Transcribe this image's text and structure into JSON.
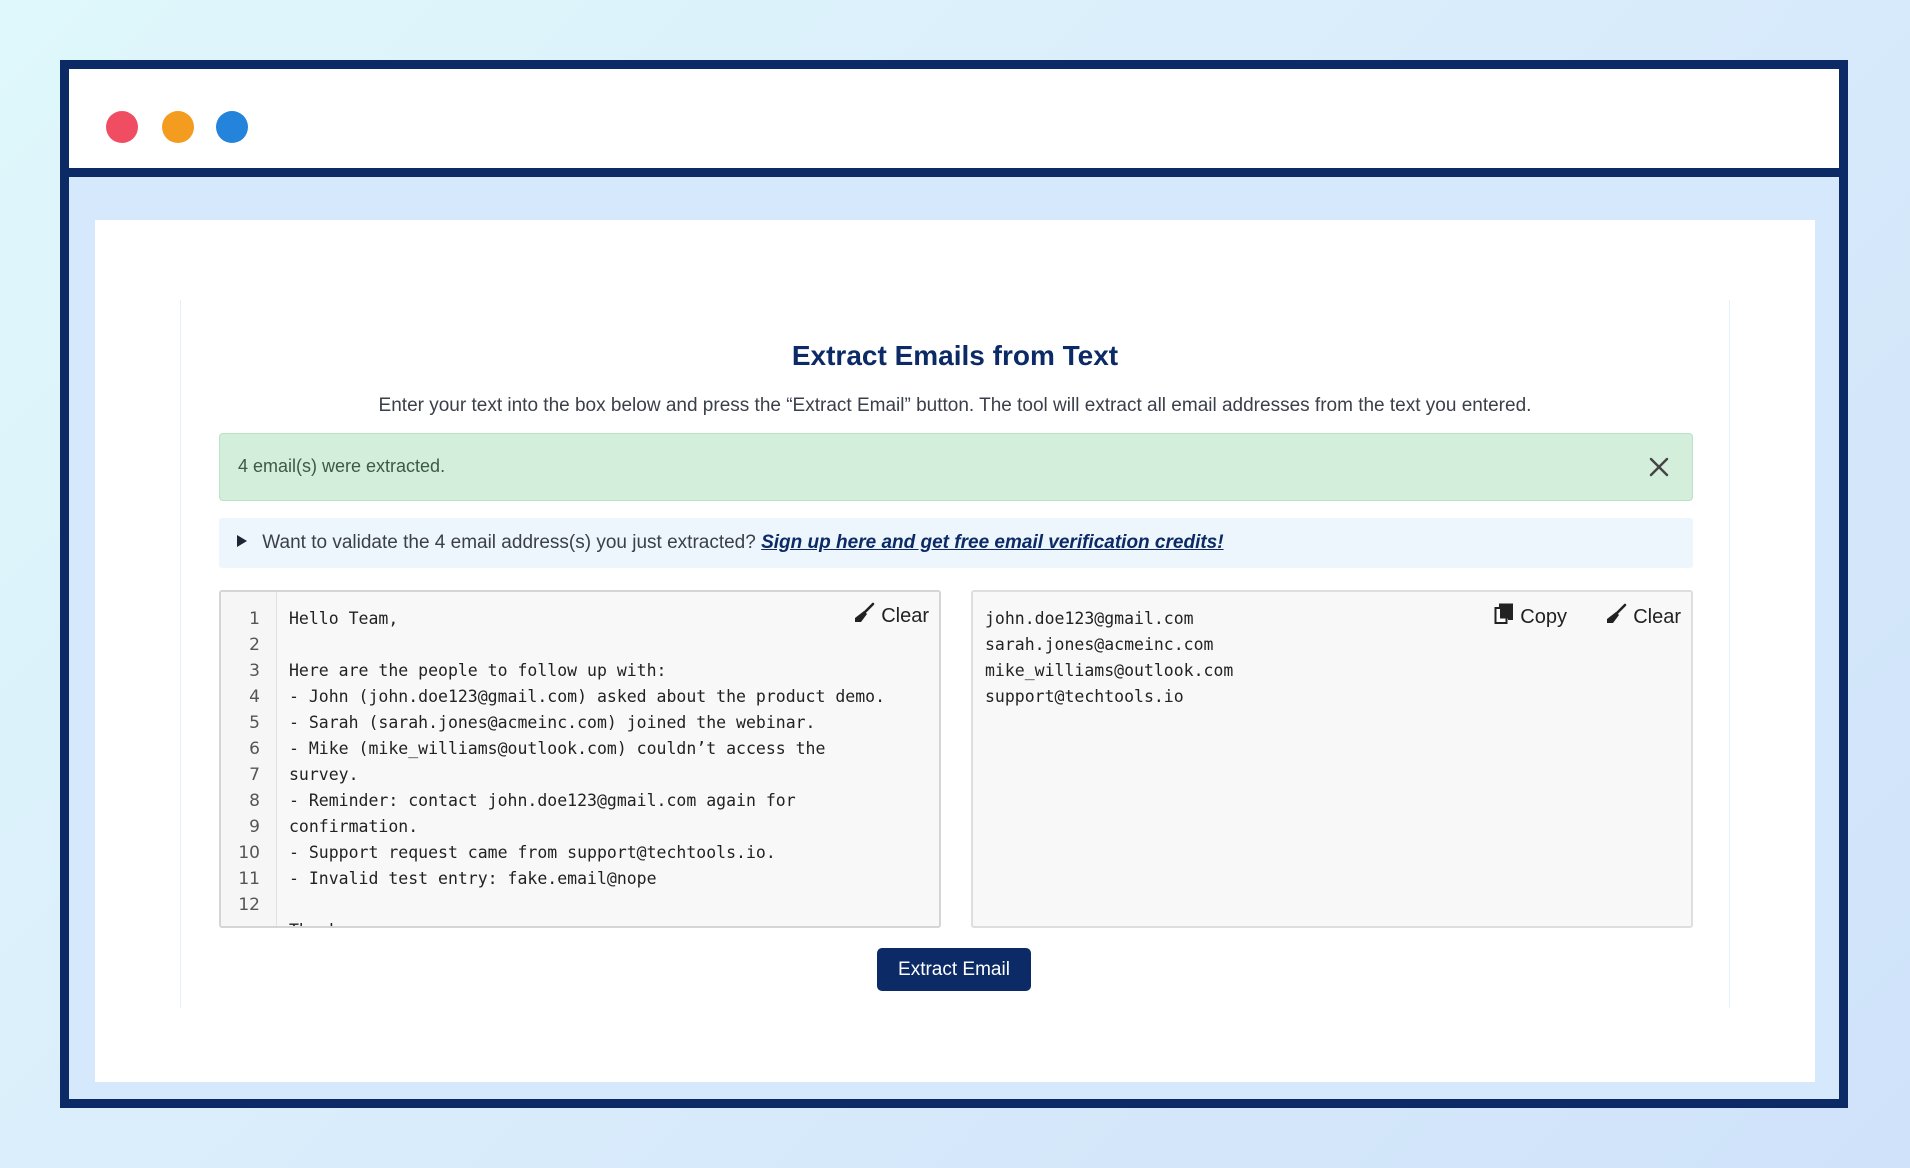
{
  "window": {
    "dots": [
      "#f14d62",
      "#f39c1f",
      "#2484dc"
    ]
  },
  "header": {
    "title": "Extract Emails from Text",
    "subtitle": "Enter your text into the box below and press the “Extract Email” button. The tool will extract all email addresses from the text you entered."
  },
  "alert": {
    "message": "4 email(s) were extracted."
  },
  "promo": {
    "text": "Want to validate the 4 email address(s) you just extracted?",
    "link": "Sign up here and get free email verification credits!"
  },
  "input_editor": {
    "clear_label": "Clear",
    "line_numbers": [
      "1",
      "2",
      "3",
      "4",
      "5",
      "6",
      "7",
      "8",
      "9",
      "10",
      "11",
      "12"
    ],
    "lines": [
      "Hello Team,",
      "",
      "Here are the people to follow up with:",
      "- John (john.doe123@gmail.com) asked about the product demo.",
      "- Sarah (sarah.jones@acmeinc.com) joined the webinar.",
      "- Mike (mike_williams@outlook.com) couldn’t access the",
      "survey.",
      "- Reminder: contact john.doe123@gmail.com again for",
      "confirmation.",
      "- Support request came from support@techtools.io.",
      "- Invalid test entry: fake.email@nope",
      "",
      "Thanks"
    ]
  },
  "output_box": {
    "copy_label": "Copy",
    "clear_label": "Clear",
    "emails": [
      "john.doe123@gmail.com",
      "sarah.jones@acmeinc.com",
      "mike_williams@outlook.com",
      "support@techtools.io"
    ]
  },
  "actions": {
    "extract_label": "Extract Email"
  }
}
